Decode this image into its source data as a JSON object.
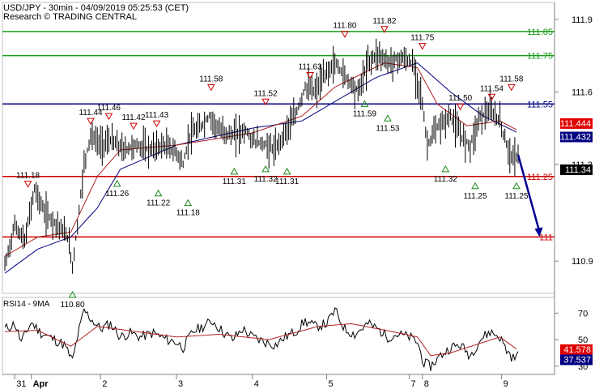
{
  "header": {
    "title": "USD/JPY - 30min - 04/09/2019 05:25:53 (CET)",
    "subtitle": "Research © TRADING CENTRAL"
  },
  "colors": {
    "green": "#1a9a1a",
    "navy": "#000080",
    "red": "#cc0000",
    "price": "#000000",
    "ma_fast": "#b22222",
    "ma_slow": "#000080",
    "rsi": "#000000",
    "rsi_ma": "#b22222",
    "arrow": "#000090"
  },
  "chart_data": [
    {
      "type": "line",
      "name": "price",
      "ylim": [
        110.78,
        111.96
      ],
      "yticks": [
        "111.9",
        "111.6",
        "111.3",
        "110.9"
      ],
      "ytick_values": [
        111.9,
        111.6,
        111.3,
        110.9
      ],
      "xticks": [
        "31",
        "Apr",
        "2",
        "3",
        "4",
        "5",
        "7",
        "8",
        "9"
      ],
      "xtick_index": [
        6,
        16,
        58,
        104,
        150,
        195,
        245,
        253,
        301
      ],
      "n_bars": 312,
      "levels": [
        {
          "value": 111.85,
          "label": "111.85",
          "color": "green"
        },
        {
          "value": 111.75,
          "label": "111.75",
          "color": "green"
        },
        {
          "value": 111.55,
          "label": "111.55",
          "color": "navy"
        },
        {
          "value": 111.25,
          "label": "111.25",
          "color": "red"
        },
        {
          "value": 111.0,
          "label": "111",
          "color": "red"
        }
      ],
      "price_tags": [
        {
          "value": 111.444,
          "label": "111.444",
          "bg": "#e00000",
          "fg": "#ffffff"
        },
        {
          "value": 111.432,
          "label": "111.432",
          "bg": "#000080",
          "fg": "#ffffff"
        },
        {
          "value": 111.34,
          "label": "111.34",
          "bg": "#000000",
          "fg": "#ffffff"
        }
      ],
      "close_path": [
        [
          0,
          110.88
        ],
        [
          6,
          111.05
        ],
        [
          12,
          110.98
        ],
        [
          18,
          111.2
        ],
        [
          24,
          111.1
        ],
        [
          32,
          111.05
        ],
        [
          38,
          111.0
        ],
        [
          41,
          110.88
        ],
        [
          44,
          111.05
        ],
        [
          48,
          111.3
        ],
        [
          52,
          111.42
        ],
        [
          58,
          111.38
        ],
        [
          64,
          111.4
        ],
        [
          72,
          111.36
        ],
        [
          80,
          111.38
        ],
        [
          88,
          111.36
        ],
        [
          96,
          111.38
        ],
        [
          104,
          111.35
        ],
        [
          108,
          111.3
        ],
        [
          112,
          111.42
        ],
        [
          118,
          111.45
        ],
        [
          124,
          111.5
        ],
        [
          130,
          111.44
        ],
        [
          138,
          111.42
        ],
        [
          146,
          111.44
        ],
        [
          150,
          111.4
        ],
        [
          158,
          111.38
        ],
        [
          164,
          111.36
        ],
        [
          170,
          111.44
        ],
        [
          176,
          111.5
        ],
        [
          182,
          111.62
        ],
        [
          188,
          111.6
        ],
        [
          195,
          111.68
        ],
        [
          200,
          111.72
        ],
        [
          208,
          111.65
        ],
        [
          214,
          111.6
        ],
        [
          220,
          111.72
        ],
        [
          226,
          111.76
        ],
        [
          232,
          111.72
        ],
        [
          240,
          111.74
        ],
        [
          247,
          111.72
        ],
        [
          252,
          111.6
        ],
        [
          256,
          111.38
        ],
        [
          262,
          111.45
        ],
        [
          270,
          111.5
        ],
        [
          276,
          111.42
        ],
        [
          282,
          111.38
        ],
        [
          288,
          111.5
        ],
        [
          294,
          111.52
        ],
        [
          300,
          111.48
        ],
        [
          304,
          111.38
        ],
        [
          308,
          111.32
        ],
        [
          311,
          111.34
        ]
      ],
      "ma_fast_path": [
        [
          0,
          110.92
        ],
        [
          20,
          111.0
        ],
        [
          40,
          111.02
        ],
        [
          56,
          111.25
        ],
        [
          70,
          111.36
        ],
        [
          104,
          111.38
        ],
        [
          150,
          111.43
        ],
        [
          180,
          111.5
        ],
        [
          200,
          111.62
        ],
        [
          230,
          111.72
        ],
        [
          250,
          111.7
        ],
        [
          262,
          111.55
        ],
        [
          280,
          111.46
        ],
        [
          300,
          111.48
        ],
        [
          311,
          111.44
        ]
      ],
      "ma_slow_path": [
        [
          0,
          110.85
        ],
        [
          20,
          110.95
        ],
        [
          40,
          111.0
        ],
        [
          56,
          111.12
        ],
        [
          70,
          111.28
        ],
        [
          104,
          111.38
        ],
        [
          150,
          111.45
        ],
        [
          180,
          111.48
        ],
        [
          200,
          111.56
        ],
        [
          225,
          111.66
        ],
        [
          250,
          111.72
        ],
        [
          270,
          111.6
        ],
        [
          290,
          111.5
        ],
        [
          311,
          111.43
        ]
      ],
      "markers": [
        {
          "i": 14,
          "v": 111.18,
          "label": "111.18",
          "dir": "down"
        },
        {
          "i": 41,
          "v": 110.8,
          "label": "110.80",
          "dir": "up"
        },
        {
          "i": 52,
          "v": 111.44,
          "label": "111.44",
          "dir": "down"
        },
        {
          "i": 63,
          "v": 111.46,
          "label": "111.46",
          "dir": "down"
        },
        {
          "i": 68,
          "v": 111.26,
          "label": "111.26",
          "dir": "up"
        },
        {
          "i": 78,
          "v": 111.42,
          "label": "111.42",
          "dir": "down"
        },
        {
          "i": 92,
          "v": 111.43,
          "label": "111.43",
          "dir": "down"
        },
        {
          "i": 93,
          "v": 111.22,
          "label": "111.22",
          "dir": "up"
        },
        {
          "i": 111,
          "v": 111.18,
          "label": "111.18",
          "dir": "up"
        },
        {
          "i": 125,
          "v": 111.58,
          "label": "111.58",
          "dir": "down"
        },
        {
          "i": 139,
          "v": 111.31,
          "label": "111.31",
          "dir": "up"
        },
        {
          "i": 158,
          "v": 111.52,
          "label": "111.52",
          "dir": "down"
        },
        {
          "i": 158,
          "v": 111.32,
          "label": "111.32",
          "dir": "up"
        },
        {
          "i": 171,
          "v": 111.31,
          "label": "111.31",
          "dir": "up"
        },
        {
          "i": 185,
          "v": 111.63,
          "label": "111.63",
          "dir": "down"
        },
        {
          "i": 206,
          "v": 111.8,
          "label": "111.80",
          "dir": "down"
        },
        {
          "i": 218,
          "v": 111.59,
          "label": "111.59",
          "dir": "up"
        },
        {
          "i": 230,
          "v": 111.82,
          "label": "111.82",
          "dir": "down"
        },
        {
          "i": 232,
          "v": 111.53,
          "label": "111.53",
          "dir": "up"
        },
        {
          "i": 253,
          "v": 111.75,
          "label": "111.75",
          "dir": "down"
        },
        {
          "i": 267,
          "v": 111.32,
          "label": "111.32",
          "dir": "up"
        },
        {
          "i": 276,
          "v": 111.5,
          "label": "111.50",
          "dir": "down"
        },
        {
          "i": 285,
          "v": 111.25,
          "label": "111.25",
          "dir": "up"
        },
        {
          "i": 295,
          "v": 111.54,
          "label": "111.54",
          "dir": "down"
        },
        {
          "i": 307,
          "v": 111.58,
          "label": "111.58",
          "dir": "down"
        },
        {
          "i": 310,
          "v": 111.25,
          "label": "111.25",
          "dir": "up"
        }
      ],
      "forecast_arrow": {
        "from": [
          311,
          111.34
        ],
        "to": [
          324,
          111.0
        ]
      }
    },
    {
      "type": "line",
      "name": "RSI14 - 9MA",
      "title": "RSI14 - 9MA",
      "ylim": [
        25,
        80
      ],
      "yticks": [
        "70",
        "50",
        "30"
      ],
      "ytick_values": [
        70,
        50,
        30
      ],
      "rsi_tags": [
        {
          "value": 41.578,
          "label": "41.578",
          "bg": "#e00000",
          "fg": "#ffffff"
        },
        {
          "value": 37.537,
          "label": "37.537",
          "bg": "#000080",
          "fg": "#ffffff"
        }
      ],
      "rsi_path": [
        [
          0,
          58
        ],
        [
          6,
          62
        ],
        [
          10,
          48
        ],
        [
          16,
          63
        ],
        [
          22,
          55
        ],
        [
          30,
          50
        ],
        [
          36,
          46
        ],
        [
          41,
          34
        ],
        [
          44,
          52
        ],
        [
          48,
          72
        ],
        [
          52,
          66
        ],
        [
          58,
          58
        ],
        [
          64,
          62
        ],
        [
          70,
          52
        ],
        [
          76,
          55
        ],
        [
          82,
          52
        ],
        [
          90,
          55
        ],
        [
          98,
          50
        ],
        [
          104,
          48
        ],
        [
          108,
          44
        ],
        [
          114,
          56
        ],
        [
          120,
          60
        ],
        [
          126,
          64
        ],
        [
          132,
          56
        ],
        [
          138,
          50
        ],
        [
          144,
          58
        ],
        [
          150,
          52
        ],
        [
          158,
          48
        ],
        [
          164,
          46
        ],
        [
          170,
          52
        ],
        [
          176,
          56
        ],
        [
          182,
          64
        ],
        [
          188,
          60
        ],
        [
          195,
          62
        ],
        [
          200,
          72
        ],
        [
          206,
          58
        ],
        [
          212,
          54
        ],
        [
          220,
          62
        ],
        [
          226,
          58
        ],
        [
          232,
          52
        ],
        [
          238,
          54
        ],
        [
          245,
          52
        ],
        [
          250,
          48
        ],
        [
          254,
          32
        ],
        [
          258,
          30
        ],
        [
          264,
          38
        ],
        [
          270,
          44
        ],
        [
          276,
          46
        ],
        [
          282,
          38
        ],
        [
          288,
          50
        ],
        [
          294,
          56
        ],
        [
          300,
          52
        ],
        [
          304,
          42
        ],
        [
          308,
          36
        ],
        [
          311,
          38
        ]
      ],
      "rsi_ma_path": [
        [
          0,
          56
        ],
        [
          20,
          57
        ],
        [
          40,
          45
        ],
        [
          56,
          60
        ],
        [
          80,
          56
        ],
        [
          104,
          52
        ],
        [
          130,
          54
        ],
        [
          160,
          50
        ],
        [
          190,
          60
        ],
        [
          210,
          62
        ],
        [
          235,
          56
        ],
        [
          250,
          52
        ],
        [
          258,
          38
        ],
        [
          270,
          40
        ],
        [
          290,
          48
        ],
        [
          300,
          52
        ],
        [
          311,
          42
        ]
      ]
    }
  ]
}
